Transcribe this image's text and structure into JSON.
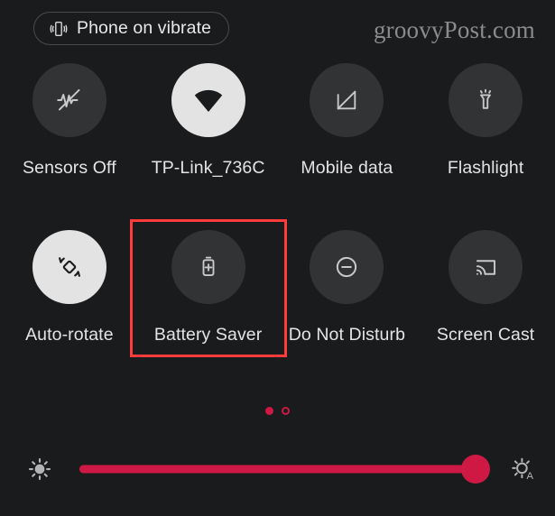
{
  "window": {
    "title": "Quick Settings",
    "background_color": "#1a1b1d"
  },
  "topbar": {
    "vibrate_chip": {
      "label": "Phone on vibrate",
      "icon": "phone-vibrate-icon"
    },
    "watermark": "groovyPost.com"
  },
  "theme": {
    "accent_red": "#cf1944",
    "highlight_red": "#ff3b3b",
    "tile_inactive": "#323335",
    "tile_active": "#e3e3e3",
    "label_color": "#e4e4e4"
  },
  "tiles": {
    "row1": [
      {
        "label": "Sensors Off",
        "icon": "sensors-off-icon",
        "state": "off"
      },
      {
        "label": "TP-Link_736C",
        "icon": "wifi-icon",
        "state": "on"
      },
      {
        "label": "Mobile data",
        "icon": "mobile-data-off-icon",
        "state": "off"
      },
      {
        "label": "Flashlight",
        "icon": "flashlight-icon",
        "state": "off"
      }
    ],
    "row2": [
      {
        "label": "Auto-rotate",
        "icon": "auto-rotate-icon",
        "state": "on"
      },
      {
        "label": "Battery Saver",
        "icon": "battery-saver-icon",
        "state": "off"
      },
      {
        "label": "Do Not Disturb",
        "icon": "do-not-disturb-icon",
        "state": "off"
      },
      {
        "label": "Screen Cast",
        "icon": "screen-cast-icon",
        "state": "off"
      }
    ]
  },
  "highlight": {
    "target_label": "Battery Saver",
    "color": "#ff3b3b"
  },
  "pager": {
    "total_pages": 2,
    "current_page": 1
  },
  "brightness": {
    "low_icon": "brightness-low-icon",
    "auto_icon": "brightness-auto-icon",
    "auto_letter": "A",
    "value_percent": 97,
    "min": 0,
    "max": 100
  }
}
